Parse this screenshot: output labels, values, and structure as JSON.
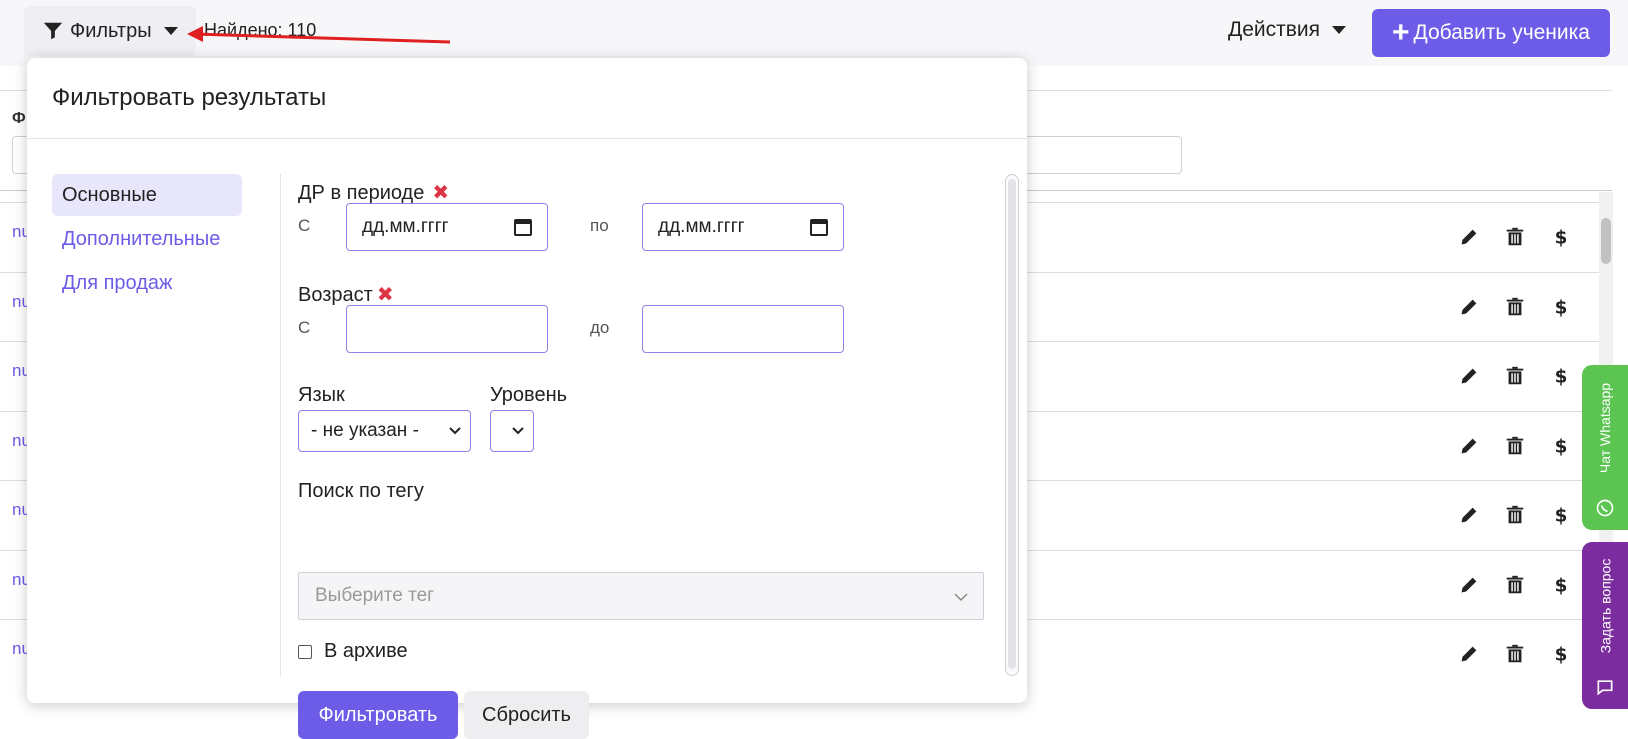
{
  "topbar": {
    "filters_label": "Фильтры",
    "found_text": "Найдено: 110",
    "actions_label": "Действия",
    "add_student_label": "Добавить ученика"
  },
  "background": {
    "row_link_text": "nu",
    "row_count": 7,
    "label_partial": "Ф"
  },
  "modal": {
    "title": "Фильтровать результаты",
    "tabs": [
      {
        "label": "Основные",
        "active": true
      },
      {
        "label": "Дополнительные",
        "active": false
      },
      {
        "label": "Для продаж",
        "active": false
      }
    ],
    "birthday": {
      "label": "ДР в периоде",
      "from_label": "С",
      "to_label": "по",
      "from_placeholder": "дд.мм.гггг",
      "to_placeholder": "дд.мм.гггг"
    },
    "age": {
      "label": "Возраст",
      "from_label": "С",
      "to_label": "до",
      "from_value": "",
      "to_value": ""
    },
    "language": {
      "label": "Язык",
      "selected": "- не указан -"
    },
    "level": {
      "label": "Уровень",
      "selected": ""
    },
    "tag_search": {
      "label": "Поиск по тегу",
      "placeholder": "Выберите тег"
    },
    "archive_label": "В архиве",
    "filter_button": "Фильтровать",
    "reset_button": "Сбросить"
  },
  "side_tabs": {
    "whatsapp": "Чат Whatsapp",
    "ask": "Задать вопрос"
  },
  "colors": {
    "accent": "#6c5ce7",
    "danger": "#dc3545",
    "whatsapp": "#5cc552",
    "ask": "#7b2c9e",
    "annotation_arrow": "#e02020"
  },
  "icons": [
    "funnel-icon",
    "caret-down-icon",
    "plus-icon",
    "pencil-icon",
    "trash-icon",
    "dollar-icon",
    "calendar-icon",
    "chevron-down-icon",
    "whatsapp-icon",
    "chat-bubble-icon",
    "close-x-icon"
  ]
}
